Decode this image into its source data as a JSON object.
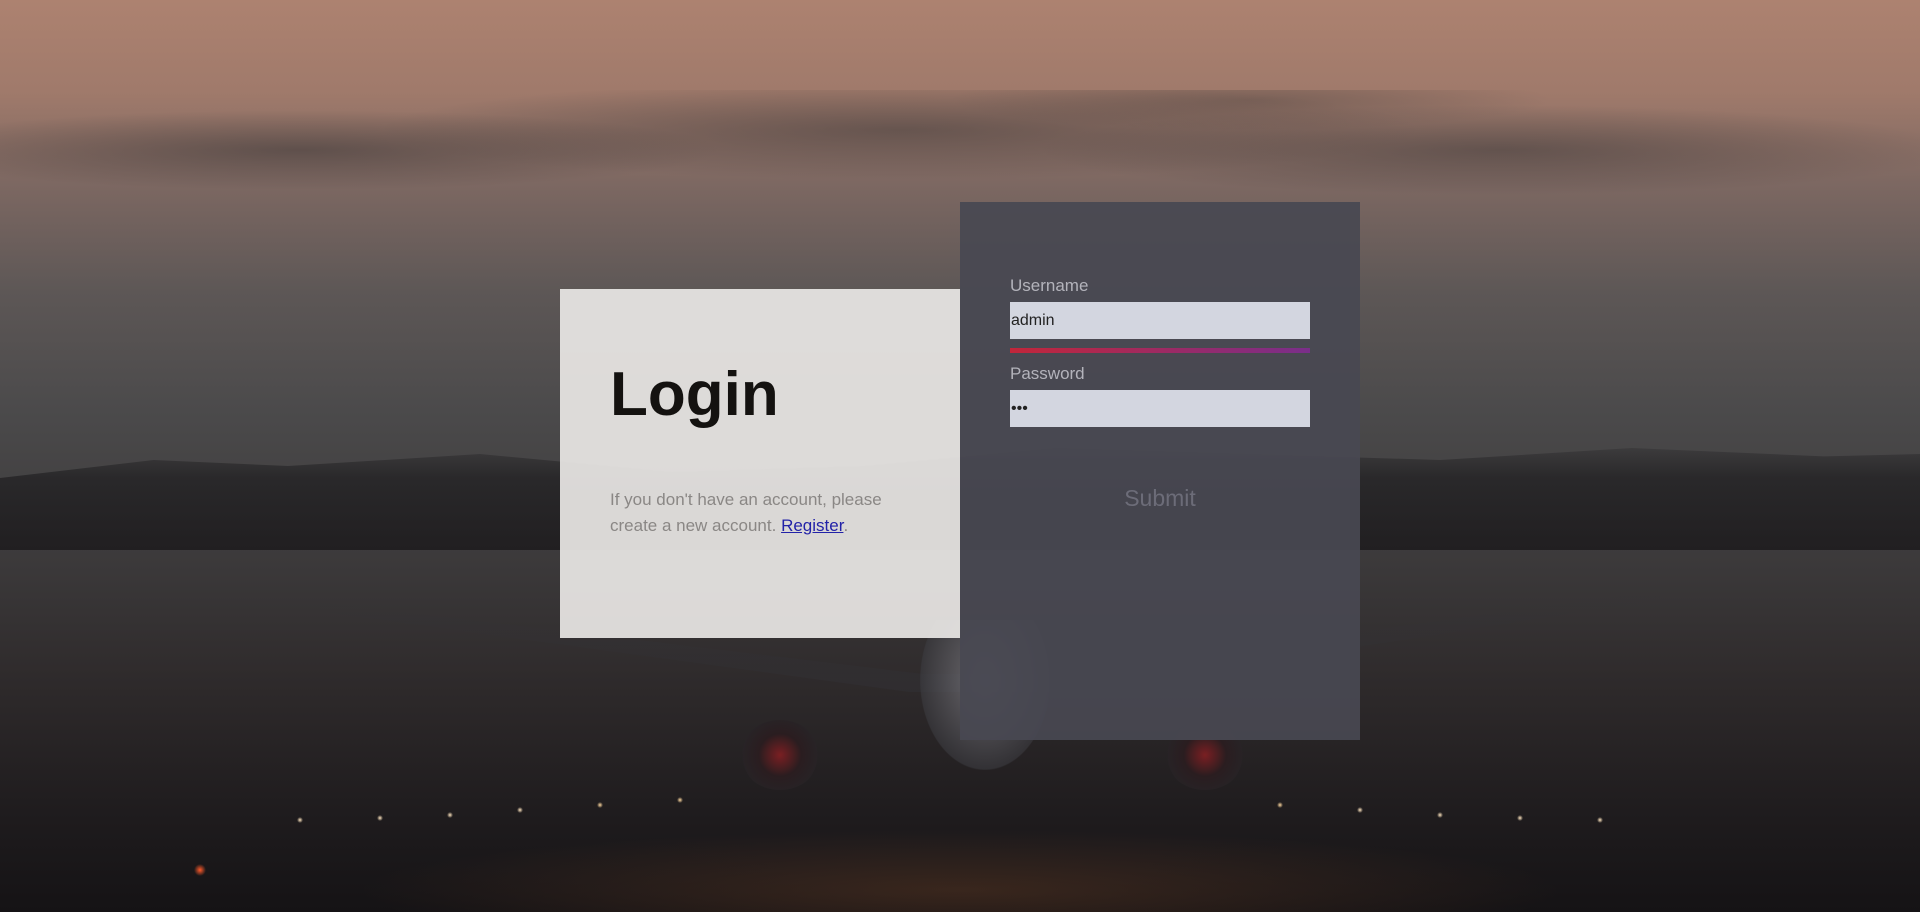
{
  "login": {
    "title": "Login",
    "register_prompt": "If you don't have an account, please create a new account.",
    "register_link": "Register",
    "register_suffix": "."
  },
  "form": {
    "username_label": "Username",
    "username_value": "admin",
    "password_label": "Password",
    "password_value": "abc",
    "submit_label": "Submit",
    "strength_colors": [
      "#c2263a",
      "#7a2e8a"
    ]
  }
}
